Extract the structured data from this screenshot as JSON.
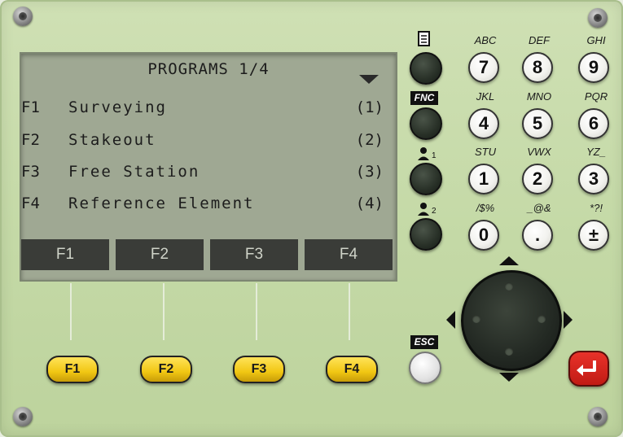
{
  "screen": {
    "title": "PROGRAMS 1/4",
    "rows": [
      {
        "key": "F1",
        "label": "Surveying",
        "num": "(1)"
      },
      {
        "key": "F2",
        "label": "Stakeout",
        "num": "(2)"
      },
      {
        "key": "F3",
        "label": "Free Station",
        "num": "(3)"
      },
      {
        "key": "F4",
        "label": "Reference Element",
        "num": "(4)"
      }
    ],
    "softkeys": [
      "F1",
      "F2",
      "F3",
      "F4"
    ]
  },
  "function_keys": [
    "F1",
    "F2",
    "F3",
    "F4"
  ],
  "side_keys": {
    "fnc": "FNC",
    "esc": "ESC",
    "icons": [
      "document-icon",
      "user1-icon",
      "user2-icon"
    ],
    "user1_sub": "1",
    "user2_sub": "2"
  },
  "keypad": [
    {
      "digit": "7",
      "letters": "ABC"
    },
    {
      "digit": "8",
      "letters": "DEF"
    },
    {
      "digit": "9",
      "letters": "GHI"
    },
    {
      "digit": "4",
      "letters": "JKL"
    },
    {
      "digit": "5",
      "letters": "MNO"
    },
    {
      "digit": "6",
      "letters": "PQR"
    },
    {
      "digit": "1",
      "letters": "STU"
    },
    {
      "digit": "2",
      "letters": "VWX"
    },
    {
      "digit": "3",
      "letters": "YZ_"
    },
    {
      "digit": "0",
      "letters": "/$%"
    },
    {
      "digit": ".",
      "letters": "_@&"
    },
    {
      "digit": "±",
      "letters": "*?!"
    }
  ],
  "colors": {
    "panel": "#c4d9a6",
    "lcd": "#9fa893",
    "softkey": "#3a3c38",
    "fkey": "#f1c713",
    "enter": "#d0241c"
  }
}
